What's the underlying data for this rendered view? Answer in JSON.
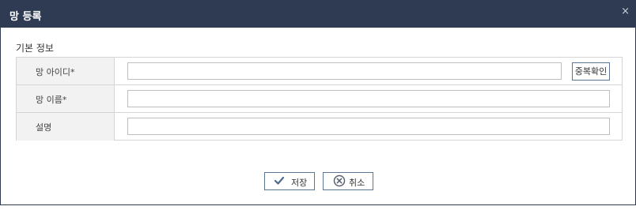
{
  "dialog": {
    "title": "망 등록",
    "close_label": "×"
  },
  "section": {
    "title": "기본 정보"
  },
  "form": {
    "fields": [
      {
        "label": "망 아이디*",
        "value": ""
      },
      {
        "label": "망 이름*",
        "value": ""
      },
      {
        "label": "설명",
        "value": ""
      }
    ],
    "duplicate_check_label": "중복확인"
  },
  "buttons": {
    "save_label": "저장",
    "cancel_label": "취소"
  },
  "icons": {
    "save": "check-icon",
    "cancel": "x-circle-icon"
  },
  "colors": {
    "titlebar": "#2e3b52",
    "label_bg": "#f2f2f2",
    "button_border": "#5b7794",
    "icon_accent": "#4a6a8f"
  }
}
